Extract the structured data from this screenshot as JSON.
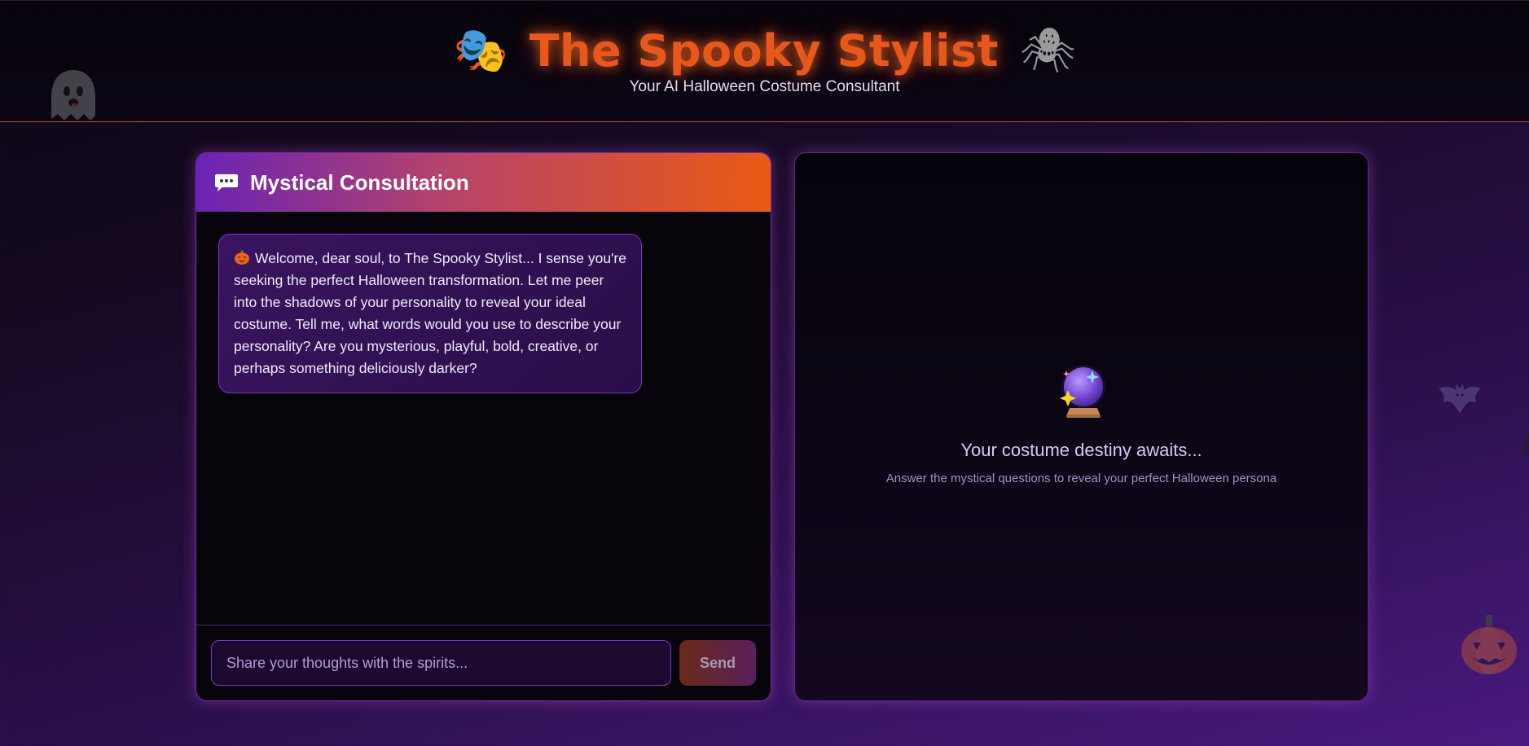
{
  "header": {
    "title": "The Spooky Stylist",
    "subtitle": "Your AI Halloween Costume Consultant",
    "left_icon": "theater-masks-icon",
    "right_icon": "spider-icon",
    "title_color": "#e8571b"
  },
  "chat": {
    "title": "Mystical Consultation",
    "header_icon": "speech-bubble-icon",
    "messages": [
      {
        "role": "assistant",
        "icon": "jack-o-lantern-icon",
        "text": "Welcome, dear soul, to The Spooky Stylist... I sense you're seeking the perfect Halloween transformation. Let me peer into the shadows of your personality to reveal your ideal costume. Tell me, what words would you use to describe your personality? Are you mysterious, playful, bold, creative, or perhaps something deliciously darker?"
      }
    ],
    "input": {
      "placeholder": "Share your thoughts with the spirits...",
      "value": ""
    },
    "send_label": "Send"
  },
  "result": {
    "icon": "crystal-ball-icon",
    "title": "Your costume destiny awaits...",
    "subtitle": "Answer the mystical questions to reveal your perfect Halloween persona"
  },
  "decorations": [
    "ghost-icon",
    "bat-icon",
    "pumpkin-icon"
  ],
  "colors": {
    "accent_orange": "#e8571b",
    "accent_purple": "#6a23b5",
    "background_dark": "#07040b"
  }
}
